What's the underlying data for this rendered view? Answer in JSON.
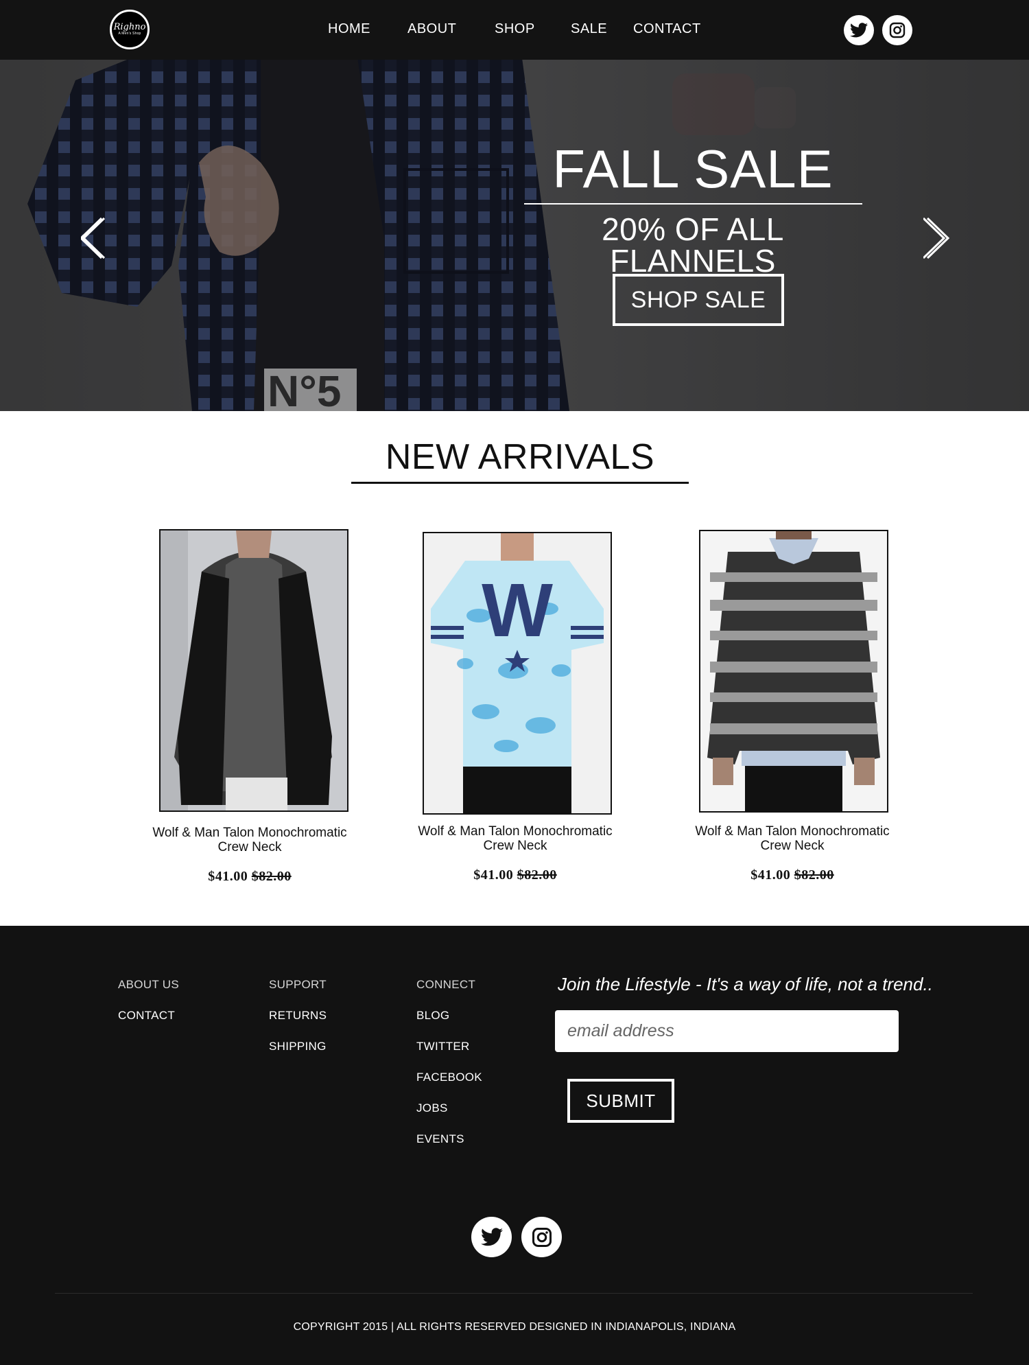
{
  "header": {
    "logo": {
      "script": "Righno",
      "tagline": "A Men's Shop"
    },
    "nav": [
      "HOME",
      "ABOUT",
      "SHOP",
      "SALE",
      "CONTACT"
    ],
    "social": [
      "twitter-icon",
      "instagram-icon"
    ]
  },
  "hero": {
    "title": "FALL SALE",
    "subtitle": "20% OF ALL FLANNELS",
    "button": "SHOP SALE",
    "prev_icon": "chevron-left-icon",
    "next_icon": "chevron-right-icon"
  },
  "new_arrivals": {
    "title": "NEW ARRIVALS",
    "products": [
      {
        "name": "Wolf & Man Talon Monochromatic Crew Neck",
        "price": "$41.00",
        "old_price": "$82.00",
        "image": "hooded-vest-photo"
      },
      {
        "name": "Wolf & Man Talon Monochromatic Crew Neck",
        "price": "$41.00",
        "old_price": "$82.00",
        "image": "w-tshirt-photo"
      },
      {
        "name": "Wolf & Man Talon Monochromatic Crew Neck",
        "price": "$41.00",
        "old_price": "$82.00",
        "image": "striped-sweater-photo"
      }
    ]
  },
  "footer": {
    "columns": [
      {
        "heading": "ABOUT US",
        "links": [
          "CONTACT"
        ]
      },
      {
        "heading": "SUPPORT",
        "links": [
          "RETURNS",
          "SHIPPING"
        ]
      },
      {
        "heading": "CONNECT",
        "links": [
          "BLOG",
          "TWITTER",
          "FACEBOOK",
          "JOBS",
          "EVENTS"
        ]
      }
    ],
    "join_text": "Join the Lifestyle - It's a way of life, not a trend..",
    "email_placeholder": "email address",
    "submit": "SUBMIT",
    "social": [
      "twitter-icon",
      "instagram-icon"
    ],
    "copyright": "COPYRIGHT 2015 | ALL RIGHTS RESERVED DESIGNED IN INDIANAPOLIS, INDIANA"
  },
  "colors": {
    "header_bg": "#131313",
    "footer_bg": "#121212",
    "text_dark": "#111111",
    "white": "#ffffff"
  }
}
